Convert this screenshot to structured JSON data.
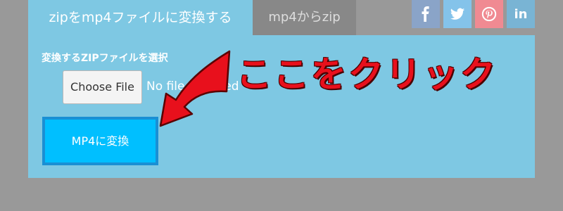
{
  "tabs": [
    {
      "label": "zipをmp4ファイルに変換する",
      "active": true
    },
    {
      "label": "mp4からzip",
      "active": false
    }
  ],
  "social": [
    {
      "icon": "facebook-icon",
      "glyph": "f"
    },
    {
      "icon": "twitter-icon",
      "glyph": ""
    },
    {
      "icon": "pinterest-icon",
      "glyph": ""
    },
    {
      "icon": "linkedin-icon",
      "glyph": "in"
    }
  ],
  "form": {
    "file_label": "変換するZIPファイルを選択",
    "choose_button": "Choose File",
    "no_file_text": "No file selected",
    "convert_button": "MP4に変換"
  },
  "annotation": {
    "text": "ここをクリック",
    "color": "#e8101c"
  },
  "colors": {
    "background": "#999999",
    "panel": "#7ec8e3",
    "tab_inactive": "#888888",
    "convert_button": "#00bfff",
    "convert_border": "#1a8fd4"
  }
}
